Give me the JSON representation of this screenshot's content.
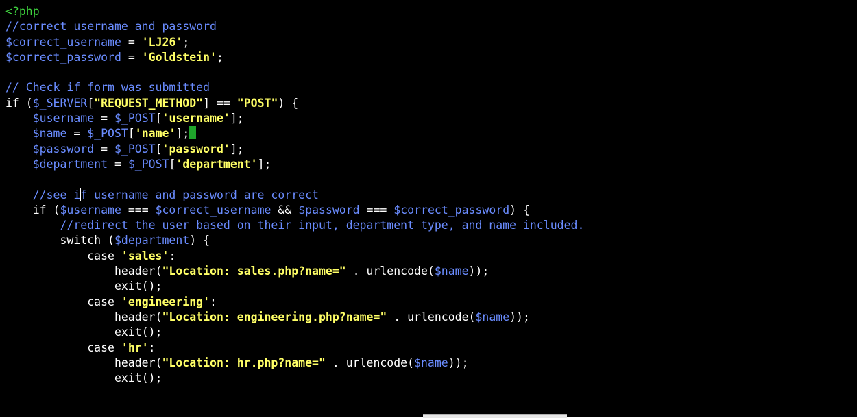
{
  "editor": {
    "lines": [
      [
        {
          "t": "<?php",
          "c": "php"
        }
      ],
      [
        {
          "t": "//correct username and password",
          "c": "comment"
        }
      ],
      [
        {
          "t": "$correct_username",
          "c": "var"
        },
        {
          "t": " = ",
          "c": "plain"
        },
        {
          "t": "'LJ26'",
          "c": "str"
        },
        {
          "t": ";",
          "c": "plain"
        }
      ],
      [
        {
          "t": "$correct_password",
          "c": "var"
        },
        {
          "t": " = ",
          "c": "plain"
        },
        {
          "t": "'Goldstein'",
          "c": "str"
        },
        {
          "t": ";",
          "c": "plain"
        }
      ],
      [],
      [
        {
          "t": "// Check if form was submitted",
          "c": "comment"
        }
      ],
      [
        {
          "t": "if",
          "c": "kw"
        },
        {
          "t": " (",
          "c": "plain"
        },
        {
          "t": "$_SERVER",
          "c": "var"
        },
        {
          "t": "[",
          "c": "plain"
        },
        {
          "t": "\"REQUEST_METHOD\"",
          "c": "str"
        },
        {
          "t": "] == ",
          "c": "plain"
        },
        {
          "t": "\"POST\"",
          "c": "str"
        },
        {
          "t": ") {",
          "c": "plain"
        }
      ],
      [
        {
          "t": "    ",
          "c": "plain"
        },
        {
          "t": "$username",
          "c": "var"
        },
        {
          "t": " = ",
          "c": "plain"
        },
        {
          "t": "$_POST",
          "c": "var"
        },
        {
          "t": "[",
          "c": "plain"
        },
        {
          "t": "'username'",
          "c": "str"
        },
        {
          "t": "];",
          "c": "plain"
        }
      ],
      [
        {
          "t": "    ",
          "c": "plain"
        },
        {
          "t": "$name",
          "c": "var"
        },
        {
          "t": " = ",
          "c": "plain"
        },
        {
          "t": "$_POST",
          "c": "var"
        },
        {
          "t": "[",
          "c": "plain"
        },
        {
          "t": "'name'",
          "c": "str"
        },
        {
          "t": "];",
          "c": "plain"
        },
        {
          "cursor": "block"
        }
      ],
      [
        {
          "t": "    ",
          "c": "plain"
        },
        {
          "t": "$password",
          "c": "var"
        },
        {
          "t": " = ",
          "c": "plain"
        },
        {
          "t": "$_POST",
          "c": "var"
        },
        {
          "t": "[",
          "c": "plain"
        },
        {
          "t": "'password'",
          "c": "str"
        },
        {
          "t": "];",
          "c": "plain"
        }
      ],
      [
        {
          "t": "    ",
          "c": "plain"
        },
        {
          "t": "$department",
          "c": "var"
        },
        {
          "t": " = ",
          "c": "plain"
        },
        {
          "t": "$_POST",
          "c": "var"
        },
        {
          "t": "[",
          "c": "plain"
        },
        {
          "t": "'department'",
          "c": "str"
        },
        {
          "t": "];",
          "c": "plain"
        }
      ],
      [],
      [
        {
          "t": "    //see i",
          "c": "comment"
        },
        {
          "cursor": "ibeam"
        },
        {
          "t": "f username and password are correct",
          "c": "comment"
        }
      ],
      [
        {
          "t": "    if",
          "c": "kw"
        },
        {
          "t": " (",
          "c": "plain"
        },
        {
          "t": "$username",
          "c": "var"
        },
        {
          "t": " === ",
          "c": "plain"
        },
        {
          "t": "$correct_username",
          "c": "var"
        },
        {
          "t": " && ",
          "c": "plain"
        },
        {
          "t": "$password",
          "c": "var"
        },
        {
          "t": " === ",
          "c": "plain"
        },
        {
          "t": "$correct_password",
          "c": "var"
        },
        {
          "t": ") {",
          "c": "plain"
        }
      ],
      [
        {
          "t": "        //redirect the user based on their input, department type, and name included.",
          "c": "comment"
        }
      ],
      [
        {
          "t": "        switch",
          "c": "kw"
        },
        {
          "t": " (",
          "c": "plain"
        },
        {
          "t": "$department",
          "c": "var"
        },
        {
          "t": ") {",
          "c": "plain"
        }
      ],
      [
        {
          "t": "            case",
          "c": "kw"
        },
        {
          "t": " ",
          "c": "plain"
        },
        {
          "t": "'sales'",
          "c": "str"
        },
        {
          "t": ":",
          "c": "plain"
        }
      ],
      [
        {
          "t": "                header(",
          "c": "plain"
        },
        {
          "t": "\"Location: sales.php?name=\"",
          "c": "str"
        },
        {
          "t": " . urlencode(",
          "c": "plain"
        },
        {
          "t": "$name",
          "c": "var"
        },
        {
          "t": "));",
          "c": "plain"
        }
      ],
      [
        {
          "t": "                exit();",
          "c": "plain"
        }
      ],
      [
        {
          "t": "            case",
          "c": "kw"
        },
        {
          "t": " ",
          "c": "plain"
        },
        {
          "t": "'engineering'",
          "c": "str"
        },
        {
          "t": ":",
          "c": "plain"
        }
      ],
      [
        {
          "t": "                header(",
          "c": "plain"
        },
        {
          "t": "\"Location: engineering.php?name=\"",
          "c": "str"
        },
        {
          "t": " . urlencode(",
          "c": "plain"
        },
        {
          "t": "$name",
          "c": "var"
        },
        {
          "t": "));",
          "c": "plain"
        }
      ],
      [
        {
          "t": "                exit();",
          "c": "plain"
        }
      ],
      [
        {
          "t": "            case",
          "c": "kw"
        },
        {
          "t": " ",
          "c": "plain"
        },
        {
          "t": "'hr'",
          "c": "str"
        },
        {
          "t": ":",
          "c": "plain"
        }
      ],
      [
        {
          "t": "                header(",
          "c": "plain"
        },
        {
          "t": "\"Location: hr.php?name=\"",
          "c": "str"
        },
        {
          "t": " . urlencode(",
          "c": "plain"
        },
        {
          "t": "$name",
          "c": "var"
        },
        {
          "t": "));",
          "c": "plain"
        }
      ],
      [
        {
          "t": "                exit();",
          "c": "plain"
        }
      ]
    ]
  },
  "colors": {
    "background": "#000000",
    "php_tag": "#3fd43f",
    "comment": "#6a8cff",
    "variable": "#6a8cff",
    "string": "#ffff66",
    "plain": "#ffffff",
    "cursor": "#1fa32b"
  }
}
